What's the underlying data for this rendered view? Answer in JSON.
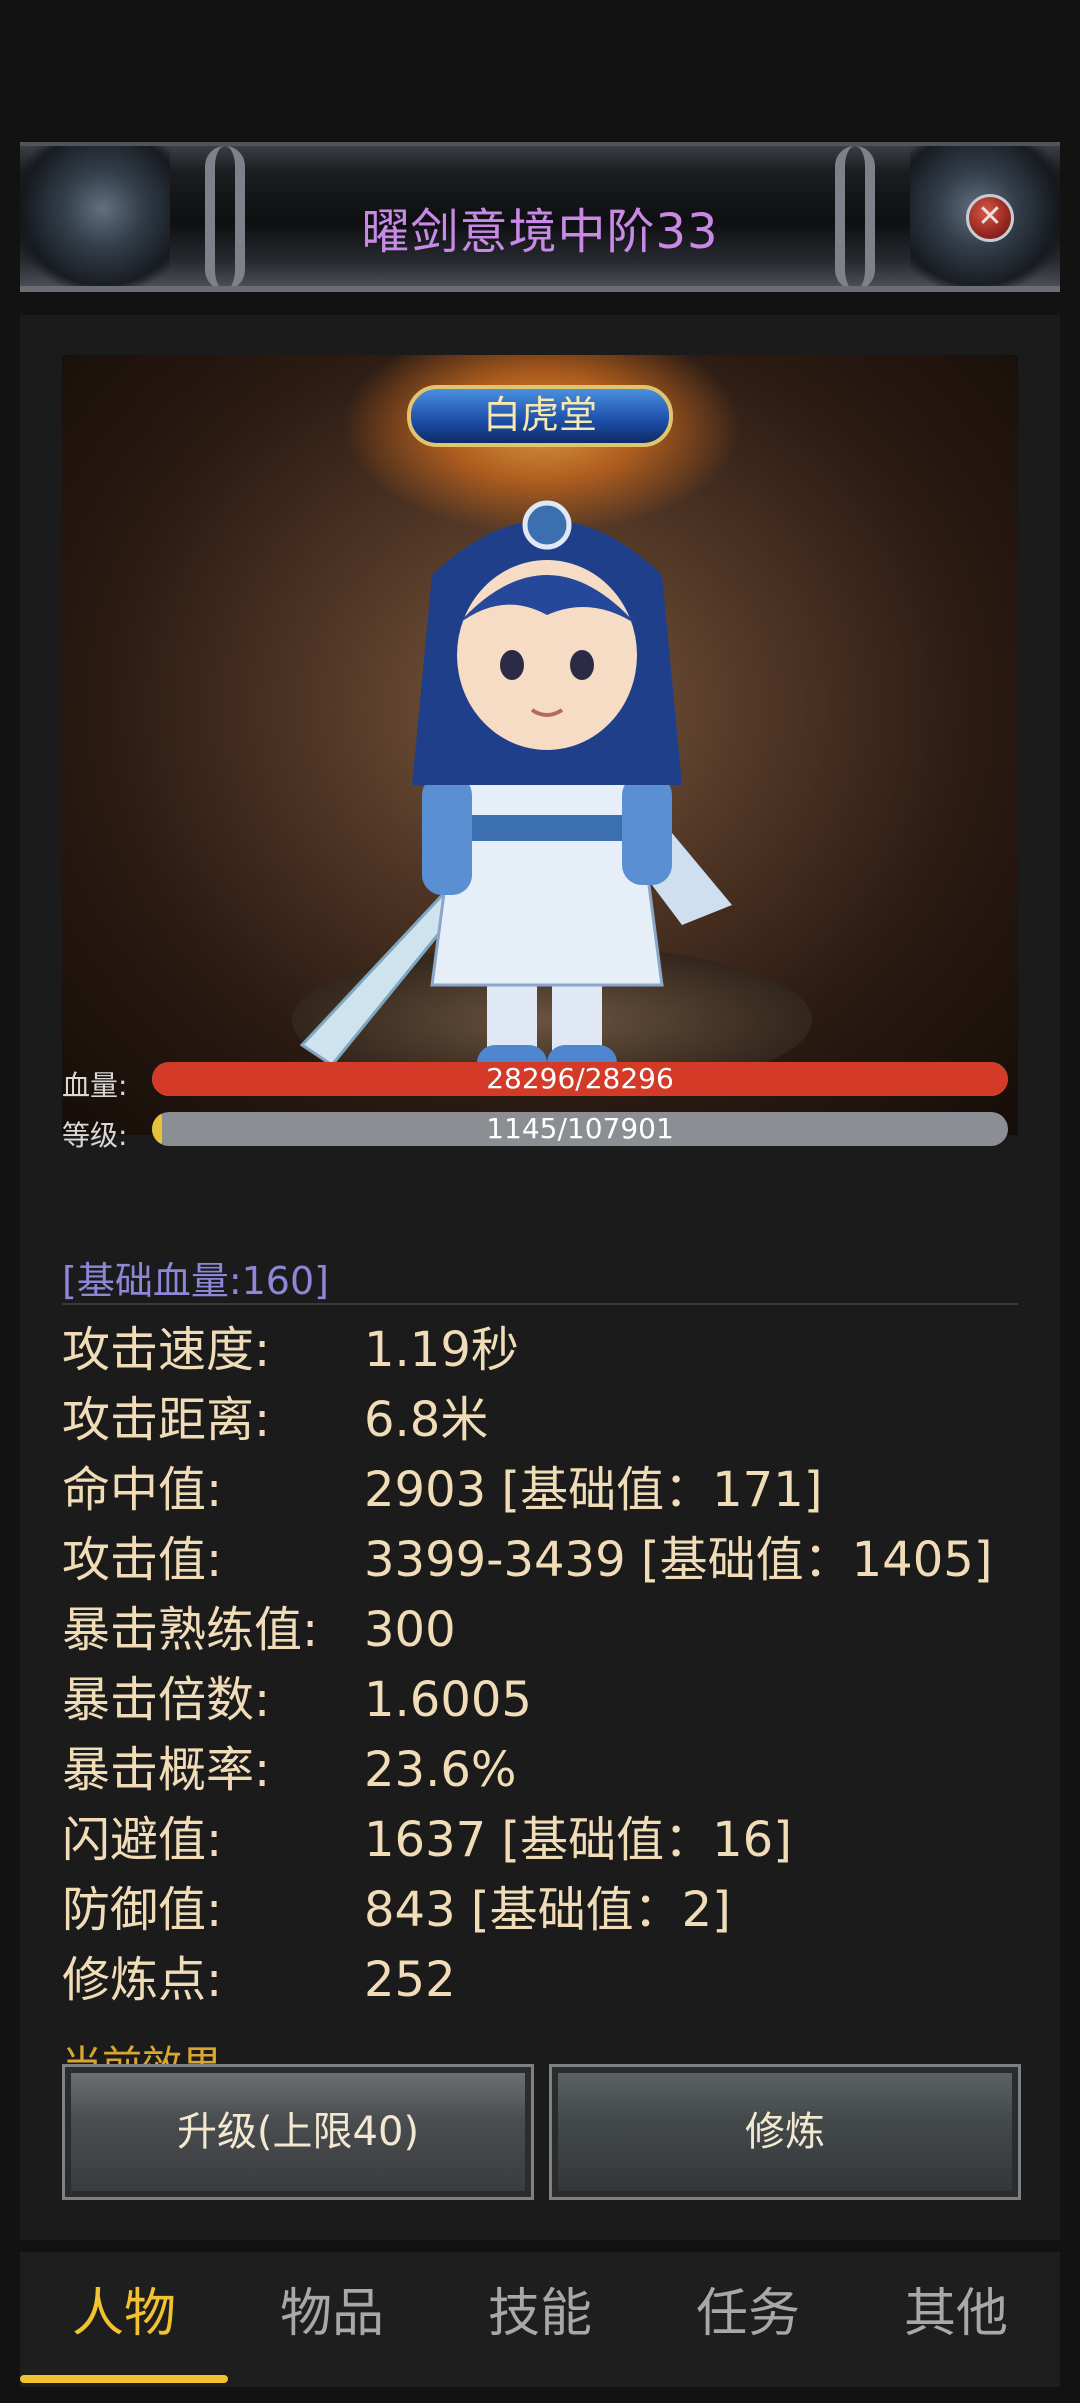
{
  "header": {
    "title": "曜剑意境中阶33",
    "close_icon": "close-icon"
  },
  "portrait": {
    "badge": "白虎堂"
  },
  "bars": {
    "hp": {
      "label": "血量:",
      "text": "28296/28296",
      "current": 28296,
      "max": 28296,
      "color": "#d43a28"
    },
    "level": {
      "label": "等级:",
      "text": "1145/107901",
      "current": 1145,
      "max": 107901,
      "color": "#e8c23a"
    }
  },
  "base_hp": "[基础血量:160]",
  "stats": [
    {
      "label": "攻击速度:",
      "value": "1.19秒"
    },
    {
      "label": "攻击距离:",
      "value": "6.8米"
    },
    {
      "label": "命中值:",
      "value": "2903 [基础值：171]"
    },
    {
      "label": "攻击值:",
      "value": "3399-3439 [基础值：1405]"
    },
    {
      "label": "暴击熟练值:",
      "value": "300"
    },
    {
      "label": "暴击倍数:",
      "value": "1.6005"
    },
    {
      "label": "暴击概率:",
      "value": "23.6%"
    },
    {
      "label": "闪避值:",
      "value": "1637 [基础值：16]"
    },
    {
      "label": "防御值:",
      "value": "843 [基础值：2]"
    },
    {
      "label": "修炼点:",
      "value": "252"
    }
  ],
  "current_effect": "当前效果",
  "buttons": {
    "upgrade": "升级(上限40)",
    "cultivate": "修炼"
  },
  "tabs": [
    {
      "label": "人物",
      "active": true
    },
    {
      "label": "物品",
      "active": false
    },
    {
      "label": "技能",
      "active": false
    },
    {
      "label": "任务",
      "active": false
    },
    {
      "label": "其他",
      "active": false
    }
  ],
  "colors": {
    "accent": "#f2c230",
    "title": "#c98ae6",
    "stat_text": "#f1dcb8"
  }
}
